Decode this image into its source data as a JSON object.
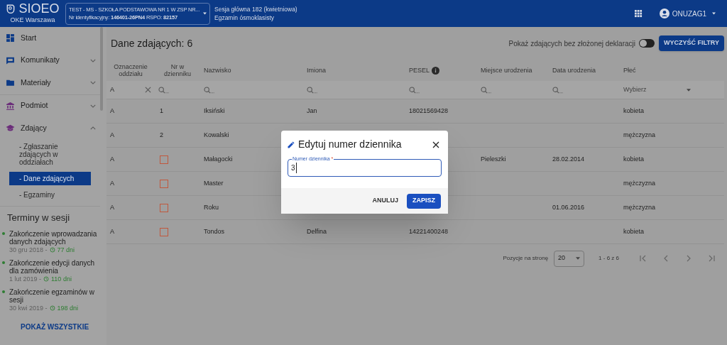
{
  "header": {
    "logo": "SIOEO",
    "org": "OKE Warszawa",
    "school": {
      "name": "TEST - MS - SZKOŁA PODSTAWOWA NR 1 W ZSP NR...",
      "ids": "Nr identyfikacyjny: **146401-26PN4** RSPO: **82157**"
    },
    "session": {
      "name": "Sesja główna 182 (kwietniowa)",
      "exam": "Egzamin ósmoklasisty"
    },
    "user": "ONUZAG1"
  },
  "sidebar": {
    "items": [
      {
        "label": "Start"
      },
      {
        "label": "Komunikaty",
        "expanded": false
      },
      {
        "label": "Materiały",
        "expanded": false
      },
      {
        "label": "Podmiot",
        "expanded": false
      },
      {
        "label": "Zdający",
        "expanded": true,
        "children": [
          {
            "label": "- Zgłaszanie zdających w oddziałach",
            "selected": false
          },
          {
            "label": "- Dane zdających",
            "selected": true
          },
          {
            "label": "- Egzaminy",
            "selected": false
          }
        ]
      }
    ],
    "deadlines_title": "Terminy w sesji",
    "deadlines": [
      {
        "title": "Zakończenie wprowadzania danych zdających",
        "date": "30 gru 2018 -",
        "days": "77 dni",
        "color": "#2e7d32"
      },
      {
        "title": "Zakończenie edycji danych dla zamówienia",
        "date": "1 lut 2019 -",
        "days": "110 dni",
        "color": "#2e7d32"
      },
      {
        "title": "Zakończenie egzaminów w sesji",
        "date": "30 kwi 2019 -",
        "days": "198 dni",
        "color": "#2e7d32"
      }
    ],
    "show_all": "POKAŻ WSZYSTKIE"
  },
  "main": {
    "title": "Dane zdających: 6",
    "toggle": {
      "label": "Pokaż zdających bez złożonej deklaracji",
      "on": false
    },
    "clear_button": "WYCZYŚĆ FILTRY",
    "table": {
      "columns": [
        "Oznaczenie oddziału",
        "Nr w dzienniku",
        "Nazwisko",
        "Imiona",
        "PESEL",
        "Miejsce urodzenia",
        "Data urodzenia",
        "Płeć"
      ],
      "filters": [
        {
          "kind": "value",
          "value": "A"
        },
        {
          "kind": "search"
        },
        {
          "kind": "search"
        },
        {
          "kind": "search"
        },
        {
          "kind": "search"
        },
        {
          "kind": "search"
        },
        {
          "kind": "search"
        },
        {
          "kind": "select",
          "placeholder": "Wybierz"
        }
      ],
      "rows": [
        {
          "cells": [
            "A",
            "1",
            "Iksiński",
            "Jan",
            "18021569428",
            "",
            "",
            "kobieta"
          ],
          "nr_missing": false
        },
        {
          "cells": [
            "A",
            "2",
            "Kowalski",
            "",
            "",
            "",
            "",
            "mężczyzna"
          ],
          "nr_missing": false
        },
        {
          "cells": [
            "A",
            "",
            "Małagocki",
            "",
            "",
            "Pieleszki",
            "28.02.2014",
            "kobieta"
          ],
          "nr_missing": true
        },
        {
          "cells": [
            "A",
            "",
            "Master",
            "",
            "",
            "",
            "",
            "mężczyzna"
          ],
          "nr_missing": true
        },
        {
          "cells": [
            "A",
            "",
            "Roku",
            "",
            "",
            "",
            "01.06.2016",
            "mężczyzna"
          ],
          "nr_missing": true
        },
        {
          "cells": [
            "A",
            "",
            "Tondos",
            "Delfina",
            "14221400248",
            "",
            "",
            "kobieta"
          ],
          "nr_missing": true
        }
      ]
    },
    "pagination": {
      "label": "Pozycje na stronę",
      "page_size": "20",
      "range": "1 - 6 z 6"
    }
  },
  "dialog": {
    "title": "Edytuj numer dziennika",
    "field_label": "Numer dziennika",
    "required_mark": "*",
    "value": "3",
    "cancel": "ANULUJ",
    "save": "ZAPISZ"
  }
}
